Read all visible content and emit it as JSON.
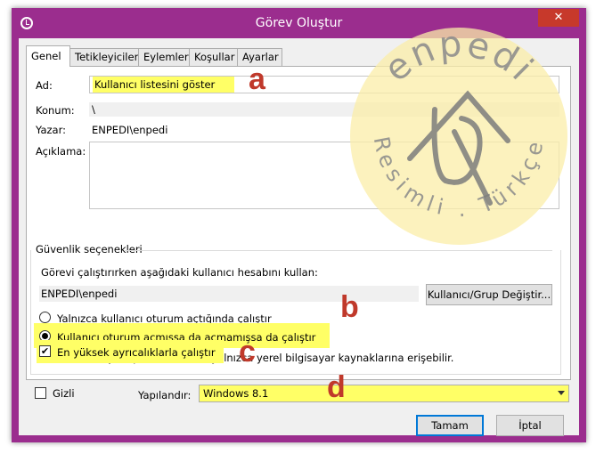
{
  "window": {
    "title": "Görev Oluştur",
    "close_glyph": "✕"
  },
  "tabs": [
    {
      "label": "Genel",
      "active": true
    },
    {
      "label": "Tetikleyiciler",
      "active": false
    },
    {
      "label": "Eylemler",
      "active": false
    },
    {
      "label": "Koşullar",
      "active": false
    },
    {
      "label": "Ayarlar",
      "active": false
    }
  ],
  "general": {
    "name_label": "Ad:",
    "name_value": "Kullanıcı listesini göster",
    "location_label": "Konum:",
    "location_value": "\\",
    "author_label": "Yazar:",
    "author_value": "ENPEDI\\enpedi",
    "description_label": "Açıklama:",
    "description_value": ""
  },
  "security": {
    "group_title": "Güvenlik seçenekleri",
    "run_as_label": "Görevi çalıştırırken aşağıdaki kullanıcı hesabını kullan:",
    "account_value": "ENPEDI\\enpedi",
    "change_button": "Kullanıcı/Grup Değiştir...",
    "radio_logged_on": "Yalnızca kullanıcı oturum açtığında çalıştır",
    "radio_whether": "Kullanıcı oturum açmışsa da açmamışsa da çalıştır",
    "no_store_password": "Parolayı depolama. Görev yalnızca yerel bilgisayar kaynaklarına erişebilir.",
    "highest_privileges": "En yüksek ayrıcalıklarla çalıştır"
  },
  "bottom": {
    "hidden_label": "Gizli",
    "configure_label": "Yapılandır:",
    "configure_value": "Windows 8.1",
    "ok_button": "Tamam",
    "cancel_button": "İptal"
  },
  "annotations": {
    "a": "a",
    "b": "b",
    "c": "c",
    "d": "d"
  },
  "watermark": {
    "brand": "enpedi",
    "tagline": "Resimli . Türkçe"
  },
  "colors": {
    "title_bar": "#9b2d8e",
    "highlight": "#ffff66",
    "annotation": "#c0392b",
    "close": "#c7392b"
  }
}
